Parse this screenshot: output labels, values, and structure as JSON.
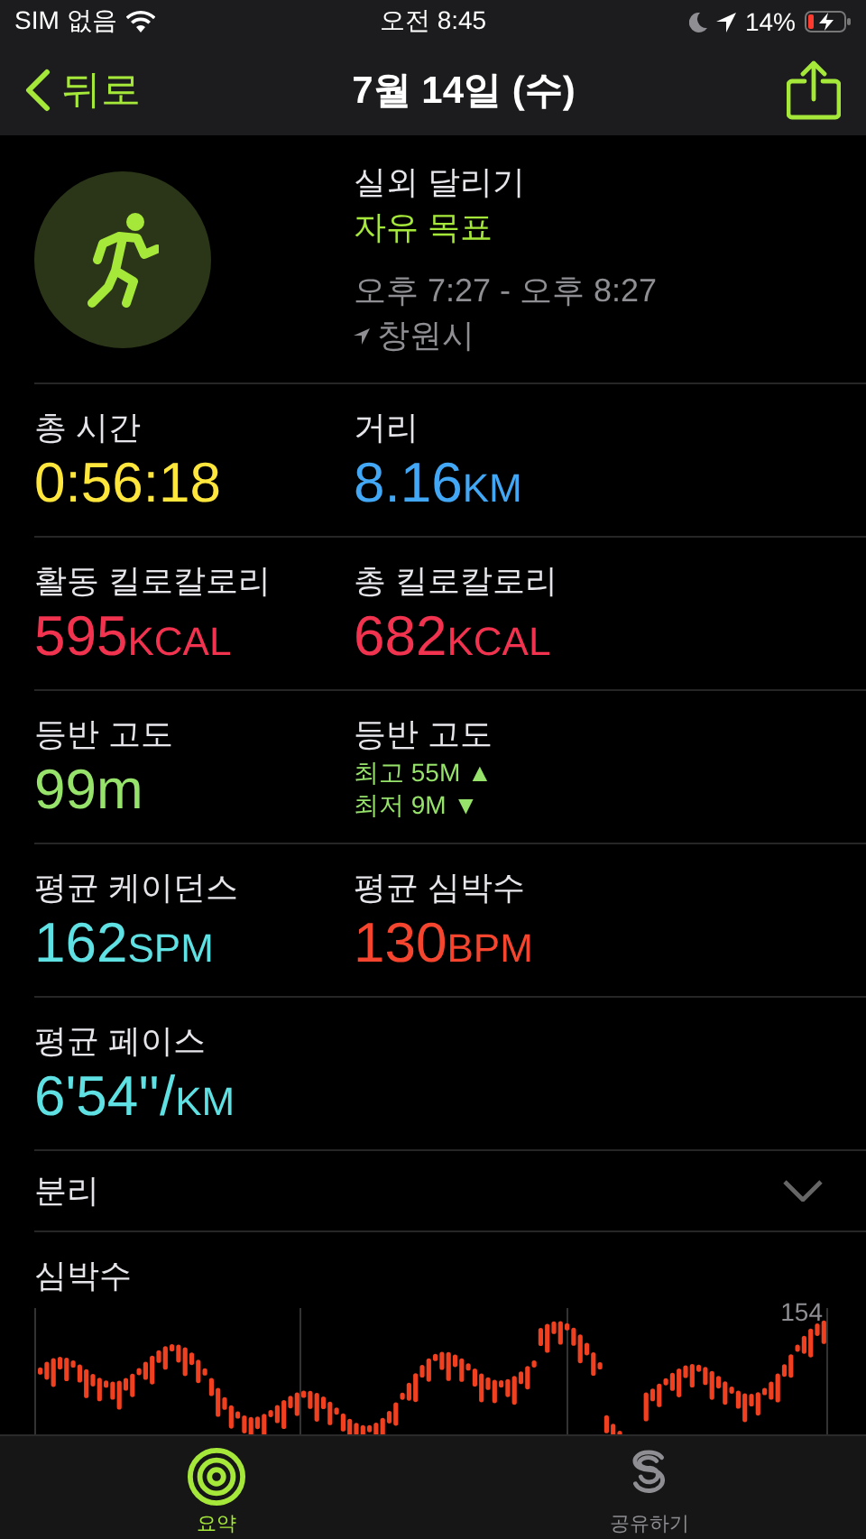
{
  "status_bar": {
    "carrier": "SIM 없음",
    "time": "오전 8:45",
    "battery": "14%"
  },
  "nav": {
    "back": "뒤로",
    "title": "7월 14일 (수)"
  },
  "workout": {
    "name": "실외 달리기",
    "goal": "자유 목표",
    "time_range": "오후 7:27 - 오후 8:27",
    "location": "창원시"
  },
  "metric_rows": [
    [
      {
        "kind": "value",
        "label": "총 시간",
        "value": "0:56:18",
        "color": "#ffe63c"
      },
      {
        "kind": "value",
        "label": "거리",
        "value": "8.16",
        "unit": "KM",
        "color": "#42a8f5"
      }
    ],
    [
      {
        "kind": "value",
        "label": "활동 킬로칼로리",
        "value": "595",
        "unit": "KCAL",
        "color": "#f2334f"
      },
      {
        "kind": "value",
        "label": "총 킬로칼로리",
        "value": "682",
        "unit": "KCAL",
        "color": "#f2334f"
      }
    ],
    [
      {
        "kind": "value",
        "label": "등반 고도",
        "value": "99m",
        "color": "#96e26a"
      },
      {
        "kind": "range",
        "label": "등반 고도",
        "color": "#96e26a",
        "lines": [
          "최고 55M ▲",
          "최저 9M ▼"
        ]
      }
    ],
    [
      {
        "kind": "value",
        "label": "평균 케이던스",
        "value": "162",
        "unit": "SPM",
        "color": "#5fe0e3"
      },
      {
        "kind": "value",
        "label": "평균 심박수",
        "value": "130",
        "unit": "BPM",
        "color": "#f5452e"
      }
    ],
    [
      {
        "kind": "value",
        "label": "평균 페이스",
        "value": "6'54''/",
        "unit": "KM",
        "color": "#5fe0e3"
      }
    ]
  ],
  "splits": {
    "label": "분리",
    "expanded": false
  },
  "heart_rate": {
    "title": "심박수",
    "max_label": "154"
  },
  "tab_bar": [
    {
      "kind": "rings",
      "label": "요약",
      "selected": true
    },
    {
      "kind": "share",
      "label": "공유하기",
      "selected": false
    }
  ]
}
